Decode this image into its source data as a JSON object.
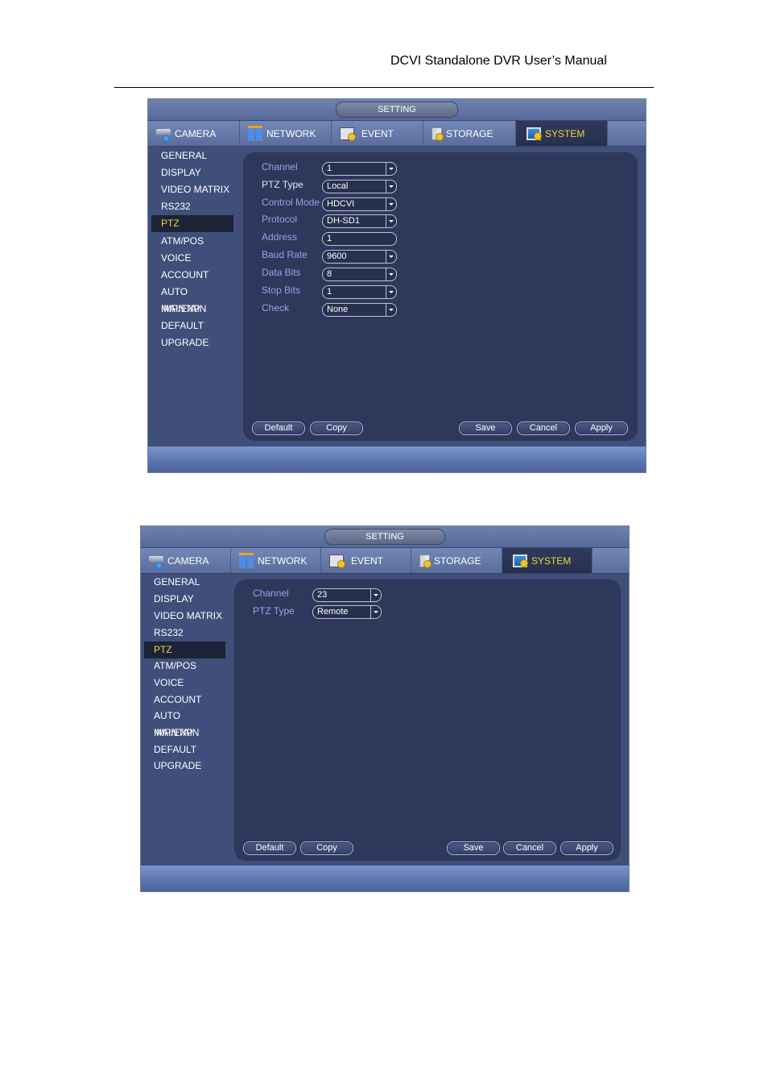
{
  "document": {
    "header": "DCVI Standalone DVR User’s Manual"
  },
  "screens": [
    {
      "title": "SETTING",
      "tabs": [
        {
          "label": "CAMERA",
          "icon": "camera-icon"
        },
        {
          "label": "NETWORK",
          "icon": "network-icon"
        },
        {
          "label": "EVENT",
          "icon": "event-icon"
        },
        {
          "label": "STORAGE",
          "icon": "storage-icon"
        },
        {
          "label": "SYSTEM",
          "icon": "system-icon",
          "active": true
        }
      ],
      "sidebar": [
        "GENERAL",
        "DISPLAY",
        "VIDEO MATRIX",
        "RS232",
        "PTZ",
        "ATM/POS",
        "VOICE",
        "ACCOUNT",
        "AUTO MAINTAIN",
        "IMP/EXP",
        "DEFAULT",
        "UPGRADE"
      ],
      "sidebar_active": "PTZ",
      "fields": [
        {
          "label": "Channel",
          "value": "1",
          "type": "select"
        },
        {
          "label": "PTZ Type",
          "value": "Local",
          "type": "select"
        },
        {
          "label": "Control Mode",
          "value": "HDCVI",
          "type": "select"
        },
        {
          "label": "Protocol",
          "value": "DH-SD1",
          "type": "select"
        },
        {
          "label": "Address",
          "value": "1",
          "type": "input"
        },
        {
          "label": "Baud Rate",
          "value": "9600",
          "type": "select"
        },
        {
          "label": "Data Bits",
          "value": "8",
          "type": "select"
        },
        {
          "label": "Stop Bits",
          "value": "1",
          "type": "select"
        },
        {
          "label": "Check",
          "value": "None",
          "type": "select"
        }
      ],
      "buttons": {
        "default": "Default",
        "copy": "Copy",
        "save": "Save",
        "cancel": "Cancel",
        "apply": "Apply"
      }
    },
    {
      "title": "SETTING",
      "tabs": [
        {
          "label": "CAMERA",
          "icon": "camera-icon"
        },
        {
          "label": "NETWORK",
          "icon": "network-icon"
        },
        {
          "label": "EVENT",
          "icon": "event-icon"
        },
        {
          "label": "STORAGE",
          "icon": "storage-icon"
        },
        {
          "label": "SYSTEM",
          "icon": "system-icon",
          "active": true
        }
      ],
      "sidebar": [
        "GENERAL",
        "DISPLAY",
        "VIDEO MATRIX",
        "RS232",
        "PTZ",
        "ATM/POS",
        "VOICE",
        "ACCOUNT",
        "AUTO MAINTAIN",
        "IMP/EXP",
        "DEFAULT",
        "UPGRADE"
      ],
      "sidebar_active": "PTZ",
      "fields": [
        {
          "label": "Channel",
          "value": "23",
          "type": "select"
        },
        {
          "label": "PTZ Type",
          "value": "Remote",
          "type": "select"
        }
      ],
      "buttons": {
        "default": "Default",
        "copy": "Copy",
        "save": "Save",
        "cancel": "Cancel",
        "apply": "Apply"
      }
    }
  ],
  "colors": {
    "active_text": "#f2d23a",
    "label_blue": "#8fa6ea",
    "panel_bg": "#2e385a",
    "window_bg": "#3f4f7a"
  }
}
